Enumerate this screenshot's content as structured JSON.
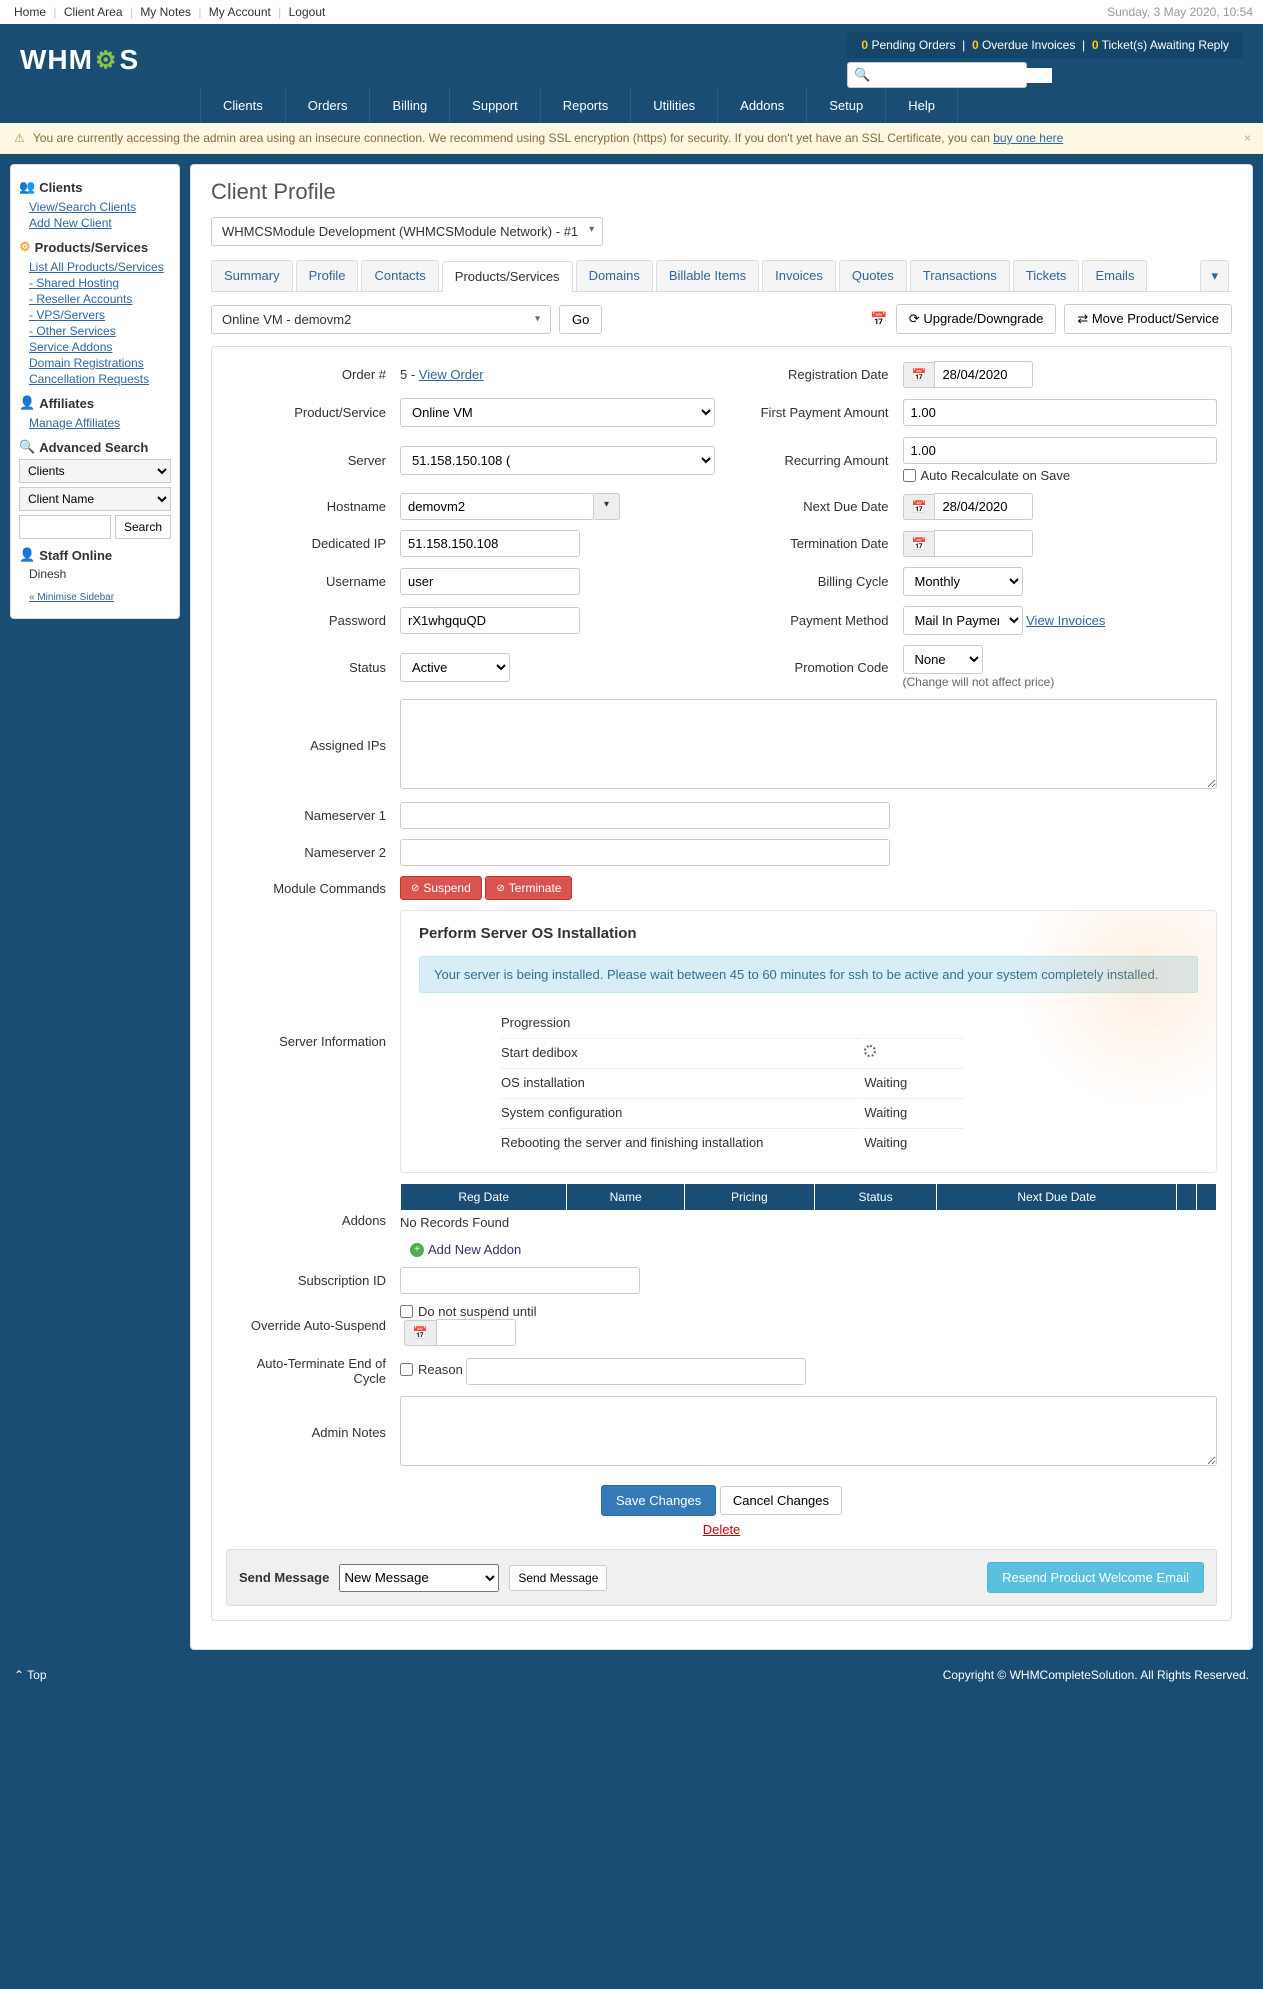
{
  "topbar": {
    "links": [
      "Home",
      "Client Area",
      "My Notes",
      "My Account",
      "Logout"
    ],
    "datetime": "Sunday, 3 May 2020, 10:54"
  },
  "logo": "WHMCS",
  "pending": {
    "orders_n": "0",
    "orders": " Pending Orders",
    "invoices_n": "0",
    "invoices": " Overdue Invoices",
    "tickets_n": "0",
    "tickets": " Ticket(s) Awaiting Reply"
  },
  "mainnav": [
    "Clients",
    "Orders",
    "Billing",
    "Support",
    "Reports",
    "Utilities",
    "Addons",
    "Setup",
    "Help"
  ],
  "warning": {
    "text": "You are currently accessing the admin area using an insecure connection. We recommend using SSL encryption (https) for security. If you don't yet have an SSL Certificate, you can ",
    "link": "buy one here"
  },
  "sidebar": {
    "clients_h": "Clients",
    "clients": [
      "View/Search Clients",
      "Add New Client"
    ],
    "products_h": "Products/Services",
    "products": [
      "List All Products/Services",
      "- Shared Hosting",
      "- Reseller Accounts",
      "- VPS/Servers",
      "- Other Services",
      "Service Addons",
      "Domain Registrations",
      "Cancellation Requests"
    ],
    "affiliates_h": "Affiliates",
    "affiliates": [
      "Manage Affiliates"
    ],
    "advsearch_h": "Advanced Search",
    "sel1": "Clients",
    "sel2": "Client Name",
    "search_btn": "Search",
    "staff_h": "Staff Online",
    "staff": "Dinesh",
    "minimise": "« Minimise Sidebar"
  },
  "page_title": "Client Profile",
  "client_selector": "WHMCSModule Development (WHMCSModule Network) - #1",
  "tabs": [
    "Summary",
    "Profile",
    "Contacts",
    "Products/Services",
    "Domains",
    "Billable Items",
    "Invoices",
    "Quotes",
    "Transactions",
    "Tickets",
    "Emails"
  ],
  "active_tab_index": 3,
  "service_dropdown": "Online VM - demovm2",
  "go": "Go",
  "upgrade": "Upgrade/Downgrade",
  "move": "Move Product/Service",
  "form": {
    "order_label": "Order #",
    "order_val": "5 - ",
    "view_order": "View Order",
    "regdate_label": "Registration Date",
    "regdate": "28/04/2020",
    "product_label": "Product/Service",
    "product": "Online VM",
    "firstpay_label": "First Payment Amount",
    "firstpay": "1.00",
    "server_label": "Server",
    "server": "51.158.150.108 (",
    "recurring_label": "Recurring Amount",
    "recurring": "1.00",
    "autorecalc": "Auto Recalculate on Save",
    "hostname_label": "Hostname",
    "hostname": "demovm2",
    "nextdue_label": "Next Due Date",
    "nextdue": "28/04/2020",
    "dedip_label": "Dedicated IP",
    "dedip": "51.158.150.108",
    "termdate_label": "Termination Date",
    "termdate": "",
    "username_label": "Username",
    "username": "user",
    "billing_label": "Billing Cycle",
    "billing": "Monthly",
    "password_label": "Password",
    "password": "rX1whgquQD",
    "paymethod_label": "Payment Method",
    "paymethod": "Mail In Payment",
    "view_invoices": "View Invoices",
    "status_label": "Status",
    "status": "Active",
    "promo_label": "Promotion Code",
    "promo": "None",
    "promo_note": "(Change will not affect price)",
    "assignedips_label": "Assigned IPs",
    "ns1_label": "Nameserver 1",
    "ns2_label": "Nameserver 2",
    "modcmd_label": "Module Commands",
    "suspend": "Suspend",
    "terminate": "Terminate",
    "serverinfo_label": "Server Information",
    "addons_label": "Addons",
    "subid_label": "Subscription ID",
    "override_label": "Override Auto-Suspend",
    "override_chk": "Do not suspend until",
    "autoterm_label": "Auto-Terminate End of Cycle",
    "autoterm_chk": "Reason",
    "notes_label": "Admin Notes"
  },
  "server_panel": {
    "title": "Perform Server OS Installation",
    "alert": "Your server is being installed. Please wait between 45 to 60 minutes for ssh to be active and your system completely installed.",
    "prog_header": "Progression",
    "rows": [
      {
        "name": "Start dedibox",
        "status": "spinner"
      },
      {
        "name": "OS installation",
        "status": "Waiting"
      },
      {
        "name": "System configuration",
        "status": "Waiting"
      },
      {
        "name": "Rebooting the server and finishing installation",
        "status": "Waiting"
      }
    ]
  },
  "addon_headers": [
    "Reg Date",
    "Name",
    "Pricing",
    "Status",
    "Next Due Date"
  ],
  "no_records": "No Records Found",
  "add_addon": "Add New Addon",
  "save": "Save Changes",
  "cancel": "Cancel Changes",
  "delete": "Delete",
  "sendmsg_label": "Send Message",
  "sendmsg_sel": "New Message",
  "sendmsg_btn": "Send Message",
  "resend": "Resend Product Welcome Email",
  "footer": {
    "top": "⌃ Top",
    "copy": "Copyright © WHMCompleteSolution. All Rights Reserved."
  }
}
